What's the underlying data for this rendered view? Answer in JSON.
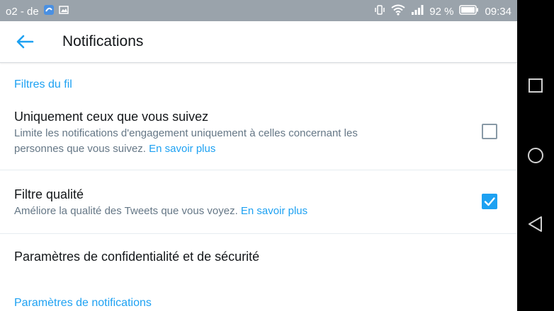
{
  "status": {
    "carrier": "o2 - de",
    "battery": "92 %",
    "time": "09:34"
  },
  "appbar": {
    "title": "Notifications"
  },
  "sections": {
    "feed_filters": "Filtres du fil",
    "notification_settings": "Paramètres de notifications"
  },
  "rows": {
    "only_following": {
      "title": "Uniquement ceux que vous suivez",
      "desc_line1": "Limite les notifications d'engagement uniquement à celles concernant les",
      "desc_line2": "personnes que vous suivez.",
      "link": "En savoir plus",
      "checked": false
    },
    "quality_filter": {
      "title": "Filtre qualité",
      "desc": "Améliore la qualité des Tweets que vous voyez.",
      "link": "En savoir plus",
      "checked": true
    },
    "privacy": {
      "title": "Paramètres de confidentialité et de sécurité"
    }
  },
  "colors": {
    "accent": "#1da1f2",
    "status_bar": "#9aa3ab",
    "text_primary": "#14171a",
    "text_secondary": "#657786"
  }
}
